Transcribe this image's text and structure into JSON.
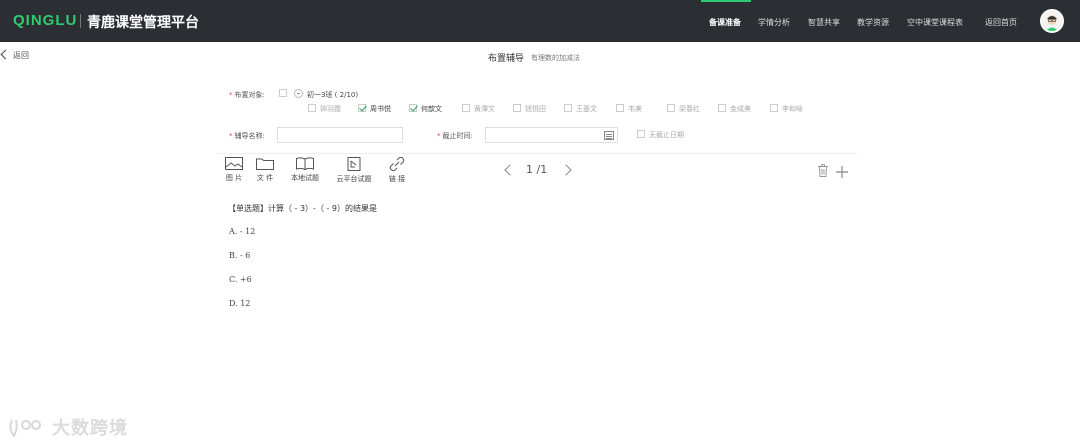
{
  "header": {
    "logo_en": "QINGLU",
    "logo_cn": "青鹿课堂管理平台",
    "nav": [
      {
        "label": "备课准备",
        "active": true
      },
      {
        "label": "学情分析",
        "active": false
      },
      {
        "label": "智慧共享",
        "active": false
      },
      {
        "label": "教学资源",
        "active": false
      },
      {
        "label": "空中课堂课程表",
        "active": false
      },
      {
        "label": "返回首页",
        "active": false
      }
    ]
  },
  "page": {
    "back_label": "返回",
    "title": "布置辅导",
    "subtitle": "有理数的加减法"
  },
  "form": {
    "target_label": "布置对象:",
    "class_name": "初一3班 ( 2/10)",
    "students": [
      {
        "name": "钟羽霞",
        "checked": false
      },
      {
        "name": "周书悦",
        "checked": true
      },
      {
        "name": "何歆文",
        "checked": true
      },
      {
        "name": "黄潭文",
        "checked": false
      },
      {
        "name": "钱悦田",
        "checked": false
      },
      {
        "name": "王基文",
        "checked": false
      },
      {
        "name": "韦美",
        "checked": false
      },
      {
        "name": "梁春红",
        "checked": false
      },
      {
        "name": "金成美",
        "checked": false
      },
      {
        "name": "李和咏",
        "checked": false
      }
    ],
    "name_label": "辅导名称:",
    "name_value": "",
    "deadline_label": "截止时间:",
    "deadline_value": "",
    "no_deadline_label": "无截止日期"
  },
  "toolbar": {
    "tools": [
      "图 片",
      "文 件",
      "本地试题",
      "云平台试题",
      "链 接"
    ],
    "pager": "1 /1"
  },
  "question": {
    "text": "【单选题】计算（ - 3）-（ - 9）的结果是",
    "options": [
      "A. - 12",
      "B. - 6",
      "C. +6",
      "D. 12"
    ]
  },
  "watermark": "大数跨境",
  "colors": {
    "accent": "#2ecc71",
    "header_bg": "#2b2e33",
    "required": "#e74c3c"
  }
}
